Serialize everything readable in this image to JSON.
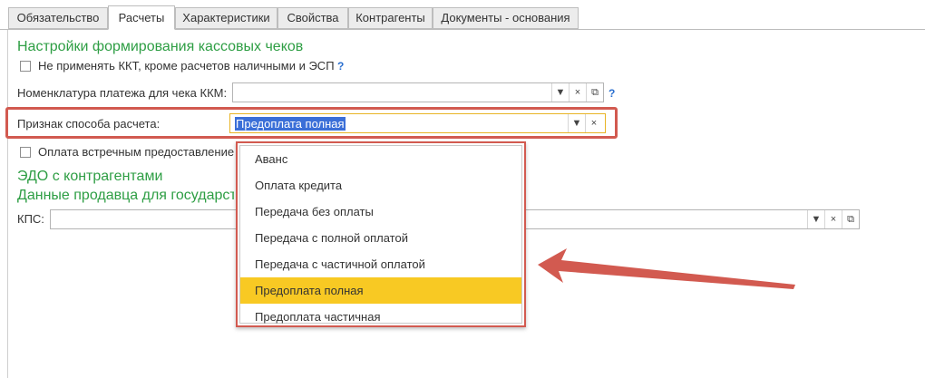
{
  "tabs": [
    {
      "label": "Обязательство",
      "active": false
    },
    {
      "label": "Расчеты",
      "active": true
    },
    {
      "label": "Характеристики",
      "active": false
    },
    {
      "label": "Свойства",
      "active": false
    },
    {
      "label": "Контрагенты",
      "active": false
    },
    {
      "label": "Документы - основания",
      "active": false
    }
  ],
  "kkt_group": {
    "title": "Настройки формирования кассовых чеков",
    "checkbox_label": "Не применять ККТ, кроме расчетов наличными и ЭСП",
    "help": "?",
    "nomenclature_label": "Номенклатура платежа для чека ККМ:",
    "nomenclature_value": "",
    "nomenclature_help": "?",
    "payment_method_label": "Признак способа расчета:",
    "payment_method_value": "Предоплата полная",
    "counter_checkbox_label": "Оплата встречным предоставлением"
  },
  "edo_group": {
    "title": "ЭДО с контрагентами",
    "seller_title": "Данные продавца для государственного",
    "kps_label": "КПС:",
    "kps_value": ""
  },
  "dropdown": {
    "options": [
      "Аванс",
      "Оплата кредита",
      "Передача без оплаты",
      "Передача с полной оплатой",
      "Передача с частичной оплатой",
      "Предоплата полная",
      "Предоплата частичная"
    ],
    "selected": "Предоплата полная"
  },
  "icons": {
    "dropdown_arrow": "▼",
    "clear": "×",
    "open": "⧉"
  },
  "colors": {
    "group_title": "#2e9e44",
    "highlight": "#d25a50",
    "selected_item": "#f8c923",
    "selection": "#3b6fd8"
  }
}
